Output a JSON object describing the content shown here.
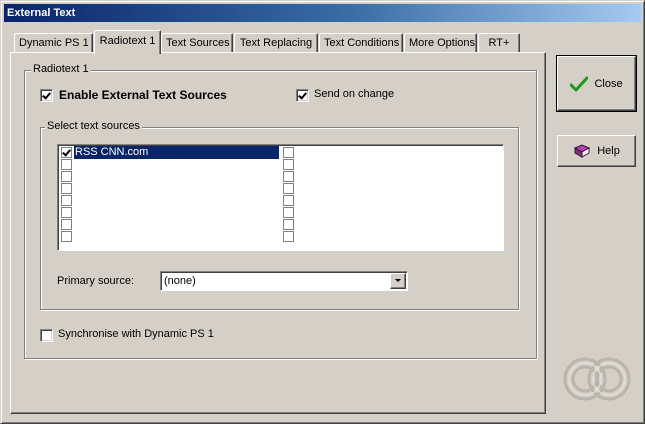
{
  "window": {
    "title": "External Text"
  },
  "tabs": [
    {
      "label": "Dynamic PS 1",
      "active": false
    },
    {
      "label": "Radiotext 1",
      "active": true
    },
    {
      "label": "Text Sources",
      "active": false
    },
    {
      "label": "Text Replacing",
      "active": false
    },
    {
      "label": "Text Conditions",
      "active": false
    },
    {
      "label": "More Options",
      "active": false
    },
    {
      "label": "RT+",
      "active": false
    }
  ],
  "radiotext": {
    "group_label": "Radiotext 1",
    "enable_external": {
      "label": "Enable External Text Sources",
      "checked": true
    },
    "send_on_change": {
      "label": "Send on change",
      "checked": true
    },
    "select_sources": {
      "group_label": "Select text sources",
      "selected_item": "RSS CNN.com",
      "left_checked": [
        true,
        false,
        false,
        false,
        false,
        false,
        false,
        false
      ],
      "right_checked": [
        false,
        false,
        false,
        false,
        false,
        false,
        false,
        false
      ]
    },
    "primary_source": {
      "label": "Primary source:",
      "value": "(none)"
    },
    "synchronise": {
      "label": "Synchronise with Dynamic PS 1",
      "checked": false
    }
  },
  "buttons": {
    "close_label": "Close",
    "help_label": "Help"
  },
  "colors": {
    "title_gradient_start": "#0a246a",
    "face": "#d4d0c8",
    "selection": "#0a246a",
    "check_icon_green": "#1a9a1a"
  },
  "icons": {
    "close": "green-checkmark-icon",
    "help": "help-book-icon",
    "logo": "app-logo-icon"
  }
}
